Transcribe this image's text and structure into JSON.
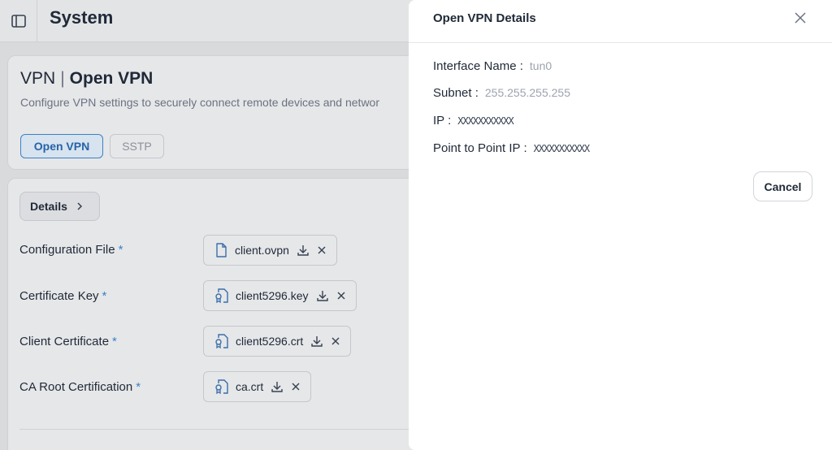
{
  "topbar": {
    "title": "System",
    "sidebar_toggle_icon": "sidebar-toggle-icon"
  },
  "vpn_card": {
    "title_left": "VPN",
    "title_separator": "|",
    "title_right": "Open VPN",
    "description": "Configure VPN settings to securely connect remote devices and networ",
    "tabs": [
      {
        "label": "Open VPN",
        "active": true
      },
      {
        "label": "SSTP",
        "active": false
      }
    ]
  },
  "details": {
    "button_label": "Details",
    "fields": [
      {
        "label": "Configuration File",
        "required": "*",
        "file": "client.ovpn",
        "icon": "file-icon"
      },
      {
        "label": "Certificate Key",
        "required": "*",
        "file": "client5296.key",
        "icon": "certificate-icon"
      },
      {
        "label": "Client Certificate",
        "required": "*",
        "file": "client5296.crt",
        "icon": "certificate-icon"
      },
      {
        "label": "CA Root Certification",
        "required": "*",
        "file": "ca.crt",
        "icon": "certificate-icon"
      }
    ]
  },
  "drawer": {
    "title": "Open VPN Details",
    "rows": [
      {
        "label": "Interface Name :",
        "value": "tun0"
      },
      {
        "label": "Subnet :",
        "value": "255.255.255.255"
      },
      {
        "label": "IP :",
        "value": "XXXXXXXXXXX"
      },
      {
        "label": "Point to Point IP :",
        "value": "XXXXXXXXXXX"
      }
    ],
    "cancel_label": "Cancel"
  },
  "colors": {
    "accent": "#3b82c4",
    "overlay_bg": "#d9dadc",
    "drawer_bg": "#ffffff"
  }
}
